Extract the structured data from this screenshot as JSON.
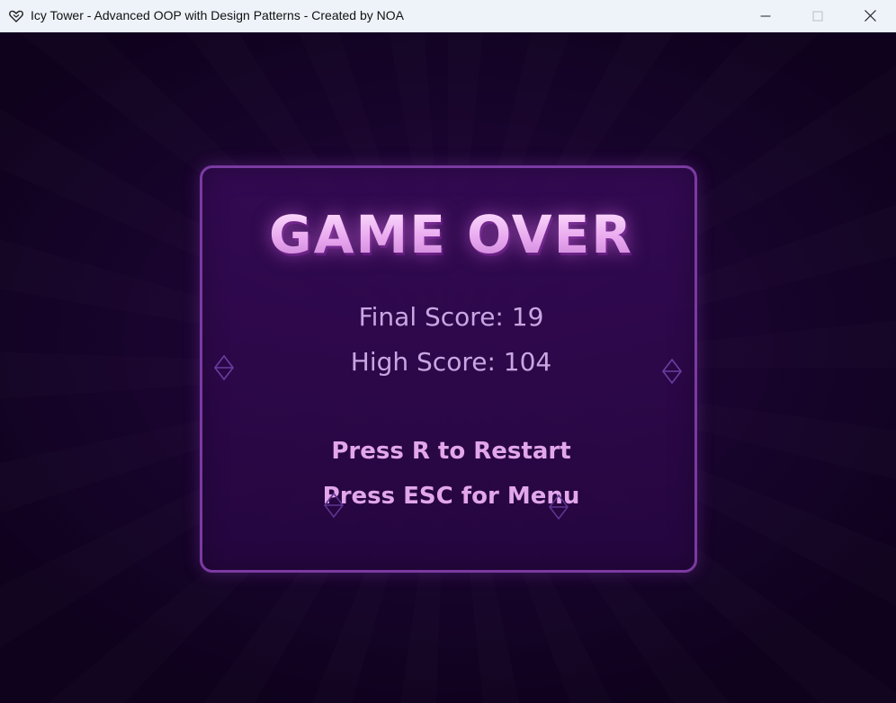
{
  "window": {
    "title": "Icy Tower - Advanced OOP with Design Patterns - Created by NOA"
  },
  "game_over": {
    "headline": "GAME OVER",
    "final_score_text": "Final Score: 19",
    "high_score_text": "High Score: 104",
    "restart_prompt": "Press R to Restart",
    "menu_prompt": "Press ESC for Menu"
  },
  "colors": {
    "panel_border": "#7b3aa2",
    "headline": "#f0c4f4",
    "score_text": "#c9a6e2",
    "prompt_text": "#e2a6ea",
    "background": "#15032a"
  }
}
